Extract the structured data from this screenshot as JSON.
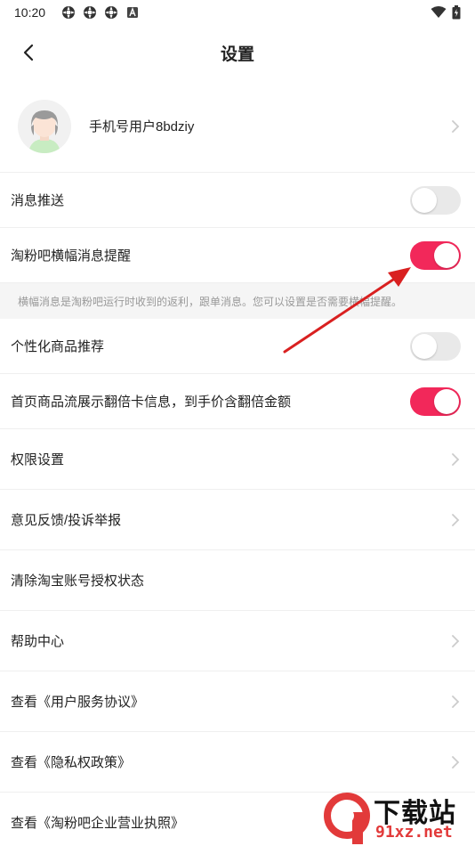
{
  "status_bar": {
    "time": "10:20",
    "left_icons": [
      "app-icon",
      "app-icon",
      "app-icon",
      "a-notification-icon"
    ],
    "right_icons": [
      "wifi-icon",
      "battery-icon"
    ]
  },
  "nav": {
    "title": "设置",
    "back_icon": "chevron-left-icon"
  },
  "profile": {
    "name": "手机号用户8bdziy"
  },
  "settings": [
    {
      "label": "消息推送",
      "type": "toggle",
      "on": false
    },
    {
      "label": "淘粉吧横幅消息提醒",
      "type": "toggle",
      "on": true
    },
    {
      "note": "横幅消息是淘粉吧运行时收到的返利，跟单消息。您可以设置是否需要横幅提醒。"
    },
    {
      "label": "个性化商品推荐",
      "type": "toggle",
      "on": false
    },
    {
      "label": "首页商品流展示翻倍卡信息，到手价含翻倍金额",
      "type": "toggle",
      "on": true
    },
    {
      "label": "权限设置",
      "type": "link"
    },
    {
      "label": "意见反馈/投诉举报",
      "type": "link"
    },
    {
      "label": "清除淘宝账号授权状态",
      "type": "action"
    },
    {
      "label": "帮助中心",
      "type": "link"
    },
    {
      "label": "查看《用户服务协议》",
      "type": "link"
    },
    {
      "label": "查看《隐私权政策》",
      "type": "link"
    },
    {
      "label": "查看《淘粉吧企业营业执照》",
      "type": "link"
    }
  ],
  "colors": {
    "accent": "#f2285a",
    "toggle_off": "#e9e9e9",
    "annotation_arrow": "#d92020"
  },
  "watermark": {
    "brand": "下载站",
    "url": "91xz.net"
  }
}
